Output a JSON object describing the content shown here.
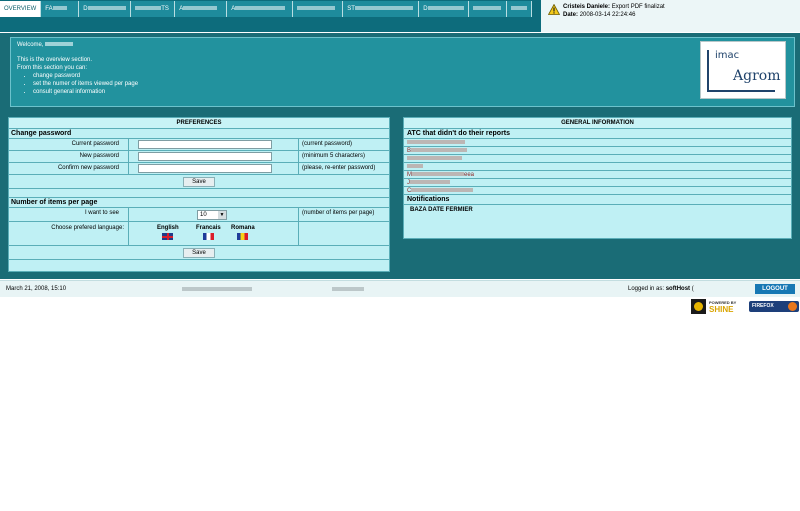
{
  "nav": {
    "tabs": [
      {
        "label": "OVERVIEW",
        "active": true
      },
      {
        "label": "FA",
        "active": false
      },
      {
        "label": "D",
        "active": false
      },
      {
        "label": "TS",
        "active": false
      },
      {
        "label": "A",
        "active": false
      },
      {
        "label": "A",
        "active": false
      },
      {
        "label": "",
        "active": false
      },
      {
        "label": "ST",
        "active": false
      },
      {
        "label": "D",
        "active": false
      },
      {
        "label": "",
        "active": false
      },
      {
        "label": "",
        "active": false
      }
    ]
  },
  "notice": {
    "author": "Cristeis Daniele:",
    "message": "Export PDF finalizat",
    "date_label": "Date:",
    "date_value": "2008-03-14 22:24:46",
    "icon": "warning-icon"
  },
  "welcome": {
    "greeting": "Welcome,",
    "line1": "This is the overview section.",
    "line2": "From this section you can:",
    "items": [
      "change password",
      "set the numer of items viewed per page",
      "consult general information"
    ],
    "logo_top": "imac",
    "logo_bottom": "Agrom"
  },
  "preferences": {
    "title": "PREFERENCES",
    "change_password": {
      "title": "Change password",
      "current_label": "Current password",
      "current_hint": "(current password)",
      "new_label": "New password",
      "new_hint": "(minimum 5 characters)",
      "confirm_label": "Confirm new password",
      "confirm_hint": "(please, re-enter password)",
      "save": "Save"
    },
    "items_per_page": {
      "title": "Number of items per page",
      "see_label": "I want to see",
      "selected": "10",
      "hint": "(number of items per page)",
      "language_label": "Choose prefered language:",
      "languages": [
        "English",
        "Francais",
        "Romana"
      ],
      "save": "Save"
    }
  },
  "general": {
    "title": "GENERAL INFORMATION",
    "atc_title": "ATC that didn't do their reports",
    "atc_rows": [
      {
        "prefix": "",
        "suffix": ""
      },
      {
        "prefix": "B",
        "suffix": ""
      },
      {
        "prefix": "",
        "suffix": ""
      },
      {
        "prefix": "",
        "suffix": ""
      },
      {
        "prefix": "M",
        "suffix": "eea"
      },
      {
        "prefix": "J",
        "suffix": ""
      },
      {
        "prefix": "C",
        "suffix": ""
      }
    ],
    "notifications_title": "Notifications",
    "notification": "BAZA DATE FERMIER"
  },
  "footer": {
    "date": "March 21, 2008, 15:10",
    "logged_label": "Logged in as:",
    "user": "softHost",
    "user_suffix": "(",
    "logout": "LOGOUT"
  },
  "badges": {
    "shine_top": "POWERED BY",
    "shine_bottom": "SHINE",
    "firefox": "FIREFOX"
  },
  "colors": {
    "nav_bg": "#0d6c7c",
    "panel_bg": "#bff0f4",
    "frame_bg": "#1a6c76",
    "logout_bg": "#1778b4"
  }
}
